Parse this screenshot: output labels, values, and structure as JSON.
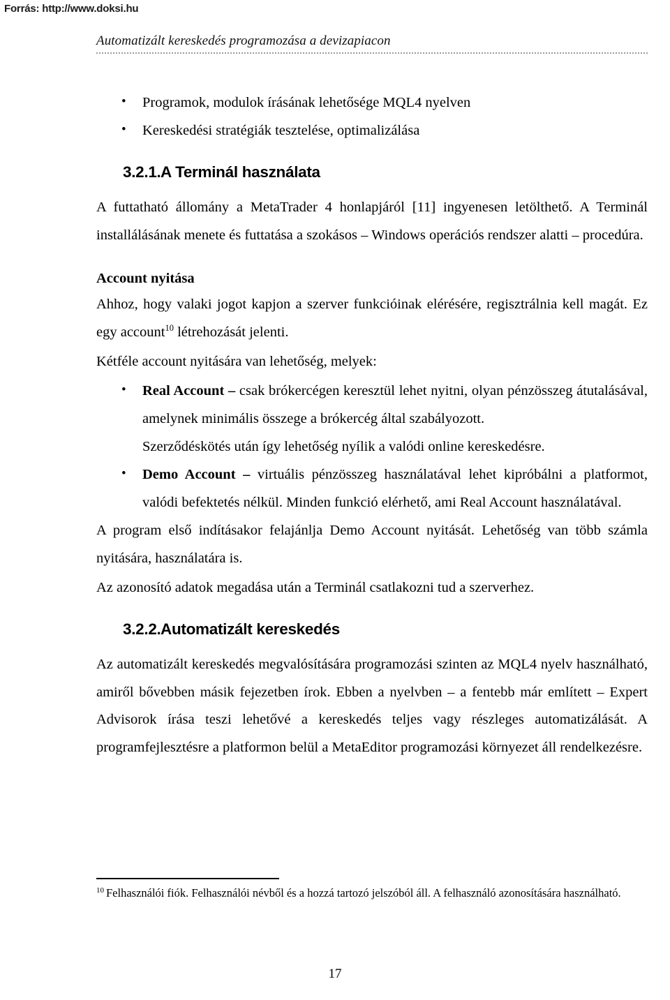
{
  "source": {
    "label": "Forrás: http://www.doksi.hu"
  },
  "header": {
    "title": "Automatizált kereskedés programozása a devizapiacon"
  },
  "intro_bullets": [
    "Programok, modulok írásának lehetősége MQL4 nyelven",
    "Kereskedési stratégiák tesztelése, optimalizálása"
  ],
  "sections": [
    {
      "number": "3.2.1.",
      "title": "A Terminál használata",
      "paragraph": "A futtatható állomány a MetaTrader 4 honlapjáról [11] ingyenesen letölthető. A Terminál installálásának menete és futtatása a szokásos – Windows operációs rendszer alatti – procedúra."
    },
    {
      "number": "3.2.2.",
      "title": "Automatizált kereskedés",
      "paragraph": "Az automatizált kereskedés megvalósítására programozási szinten az MQL4 nyelv használható, amiről bővebben másik fejezetben írok. Ebben a nyelvben – a fentebb már említett – Expert Advisorok írása teszi lehetővé a kereskedés teljes vagy részleges automatizálását. A programfejlesztésre a platformon belül a MetaEditor programozási környezet áll rendelkezésre."
    }
  ],
  "account_section": {
    "subheading": "Account nyitása",
    "para1_a": "Ahhoz, hogy valaki jogot kapjon a szerver funkcióinak elérésére, regisztrálnia kell magát. Ez egy account",
    "para1_sup": "10",
    "para1_b": " létrehozását jelenti.",
    "para2": "Kétféle account nyitására van lehetőség, melyek:",
    "bullets": [
      {
        "term": "Real Account",
        "dash": " – ",
        "text": "csak brókercégen keresztül lehet nyitni, olyan pénzösszeg átutalásával, amelynek minimális összege a brókercég által szabályozott.",
        "continuation": "Szerződéskötés után így lehetőség nyílik a valódi online kereskedésre."
      },
      {
        "term": "Demo Account",
        "dash": " – ",
        "text": "virtuális pénzösszeg használatával lehet kipróbálni a platformot, valódi befektetés nélkül. Minden funkció elérhető, ami Real Account használatával.",
        "continuation": ""
      }
    ],
    "para3": "A program első indításakor felajánlja Demo Account nyitását. Lehetőség van több számla nyitására, használatára is.",
    "para4": "Az azonosító adatok megadása után a Terminál csatlakozni tud a szerverhez."
  },
  "footnote": {
    "marker": "10",
    "text": "Felhasználói fiók. Felhasználói névből és a hozzá tartozó jelszóból áll. A felhasználó azonosítására használható."
  },
  "page_number": "17"
}
